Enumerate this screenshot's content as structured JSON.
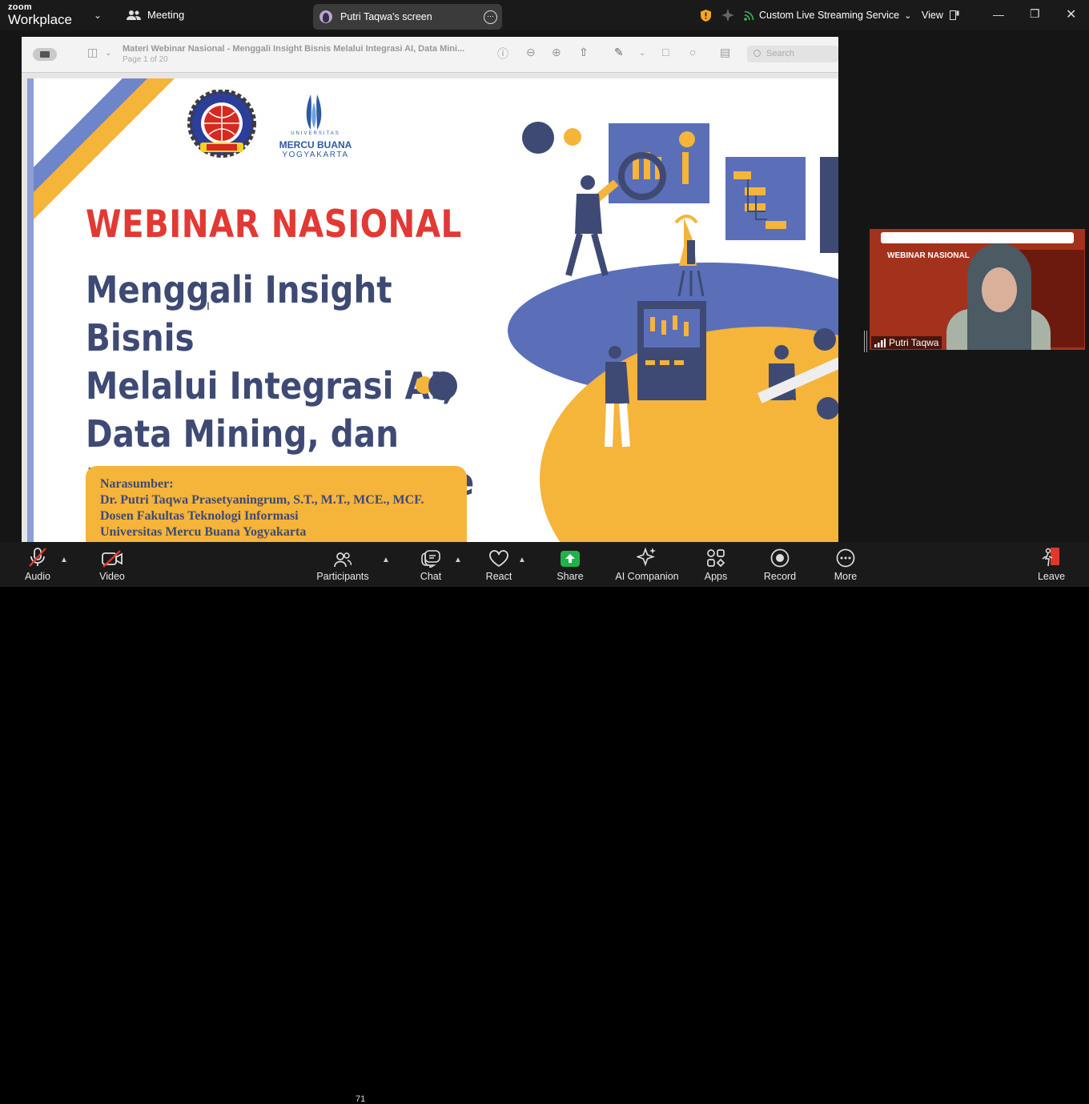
{
  "app": {
    "brand_top": "zoom",
    "brand_bottom": "Workplace",
    "meeting_label": "Meeting"
  },
  "screen_share": {
    "label": "Putri Taqwa's screen"
  },
  "topbar": {
    "streaming_label": "Custom Live Streaming Service",
    "view_label": "View"
  },
  "pdf_viewer": {
    "doc_title": "Materi Webinar Nasional - Menggali Insight Bisnis Melalui Integrasi AI, Data Mini...",
    "page_count": "Page 1 of 20",
    "search_placeholder": "Search"
  },
  "slide": {
    "kicker": "WEBINAR NASIONAL",
    "title_lines": [
      "Menggali Insight Bisnis",
      "Melalui Integrasi AI,",
      "Data Mining, dan",
      "Business Intelligence"
    ],
    "speaker_lines": [
      "Narasumber:",
      "Dr. Putri Taqwa Prasetyaningrum, S.T., M.T., MCE., MCF.",
      "Dosen Fakultas Teknologi Informasi",
      "Universitas Mercu Buana Yogyakarta"
    ],
    "logo2_top": "UNIVERSITAS",
    "logo2_name": "MERCU BUANA",
    "logo2_city": "YOGYAKARTA",
    "logo1_ring_text": "UNIVERSITAS SAINS & TEKNOLOGI KOMPUTER",
    "logo1_banner": "STEKOM"
  },
  "video_tile": {
    "name": "Putri Taqwa",
    "banner_title": "WEBINAR NASIONAL"
  },
  "toolbar": {
    "audio": "Audio",
    "video": "Video",
    "participants": "Participants",
    "participants_count": "71",
    "chat": "Chat",
    "react": "React",
    "share": "Share",
    "ai_companion": "AI Companion",
    "apps": "Apps",
    "record": "Record",
    "more": "More",
    "leave": "Leave"
  },
  "colors": {
    "accent_green": "#21b34b",
    "leave_red": "#e0372d",
    "slide_red": "#e23934",
    "slide_navy": "#3e4a74",
    "slide_yellow": "#f5b43a"
  }
}
